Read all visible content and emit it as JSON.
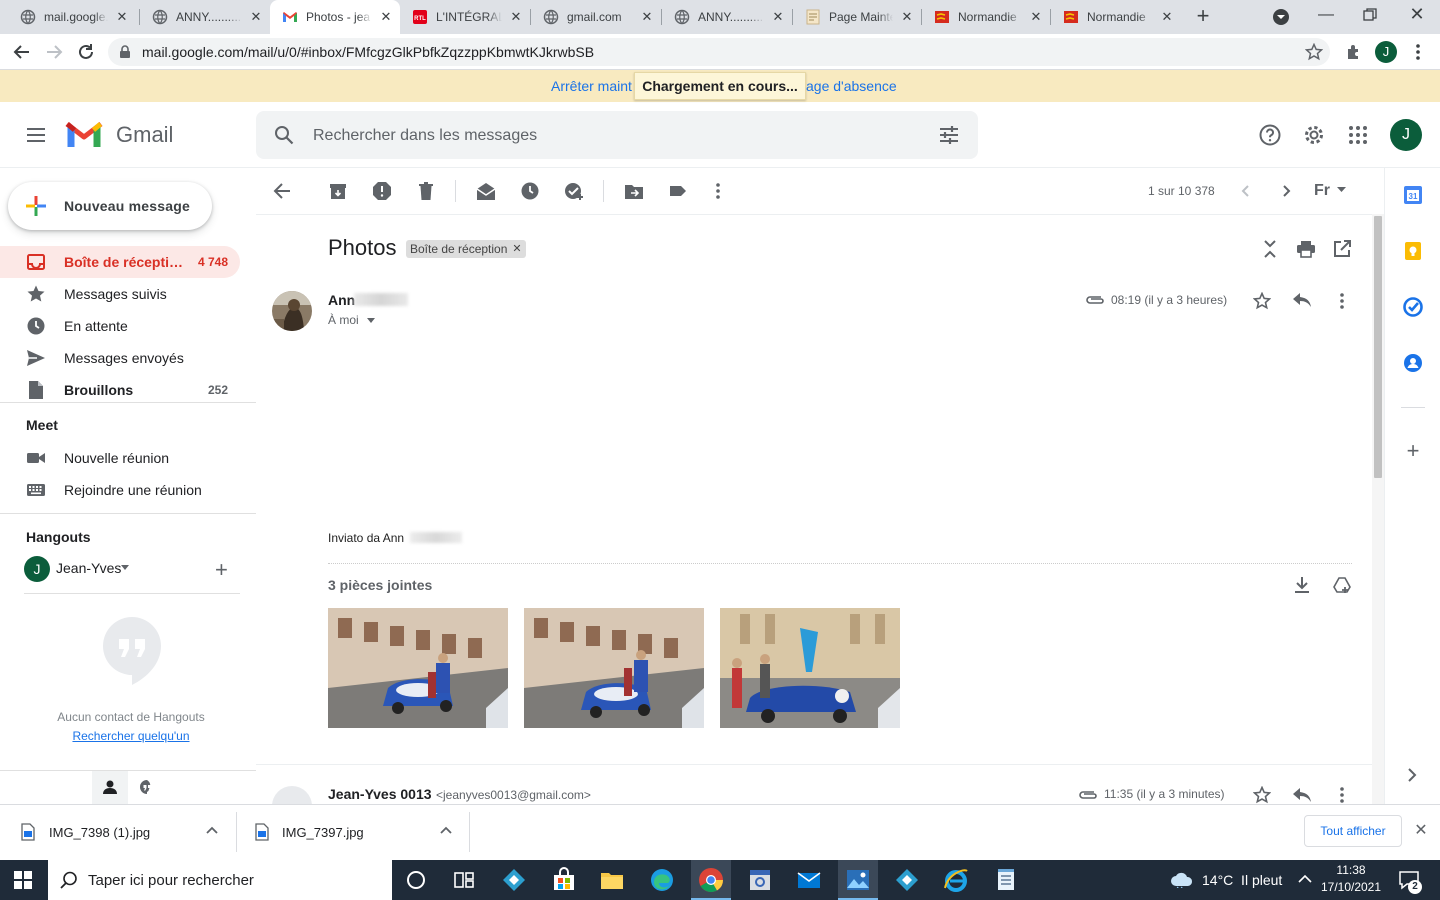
{
  "browser": {
    "tabs": [
      {
        "title": "mail.google.",
        "favicon": "globe-icon"
      },
      {
        "title": "ANNY............",
        "favicon": "globe-icon"
      },
      {
        "title": "Photos - jea",
        "favicon": "gmail-icon",
        "active": true
      },
      {
        "title": "L'INTÉGRALE",
        "favicon": "rtl-icon"
      },
      {
        "title": "gmail.com",
        "favicon": "globe-icon"
      },
      {
        "title": "ANNY............",
        "favicon": "globe-icon"
      },
      {
        "title": "Page Mainte",
        "favicon": "page-icon"
      },
      {
        "title": "Normandie",
        "favicon": "normandie-flag-icon"
      },
      {
        "title": "Normandie",
        "favicon": "normandie-flag-icon"
      }
    ],
    "url": "mail.google.com/mail/u/0/#inbox/FMfcgzGlkPbfkZqzzppKbmwtKJkrwbSB",
    "profile_initial": "J"
  },
  "vacation_bar": {
    "left_text": "Arrêter maint",
    "right_text": "age d'absence",
    "loading": "Chargement en cours..."
  },
  "gmail": {
    "logo_text": "Gmail",
    "search_placeholder": "Rechercher dans les messages",
    "account_initial": "J",
    "compose_label": "Nouveau message",
    "nav": [
      {
        "label": "Boîte de récepti…",
        "count": "4 748",
        "icon": "inbox-icon",
        "active": true
      },
      {
        "label": "Messages suivis",
        "count": "",
        "icon": "star-icon"
      },
      {
        "label": "En attente",
        "count": "",
        "icon": "clock-icon"
      },
      {
        "label": "Messages envoyés",
        "count": "",
        "icon": "send-icon"
      },
      {
        "label": "Brouillons",
        "count": "252",
        "icon": "draft-icon"
      }
    ],
    "meet": {
      "title": "Meet",
      "new_meeting": "Nouvelle réunion",
      "join_meeting": "Rejoindre une réunion"
    },
    "hangouts": {
      "title": "Hangouts",
      "user_initial": "J",
      "user_name": "Jean-Yves",
      "empty_text": "Aucun contact de Hangouts",
      "search_link": "Rechercher quelqu'un"
    },
    "pagination": "1 sur 10 378",
    "lang_label": "Fr",
    "thread": {
      "subject": "Photos",
      "label_chip": "Boîte de réception",
      "message1": {
        "sender": "Ann",
        "recipient": "À moi",
        "time": "08:19 (il y a 3 heures)",
        "body": "Inviato da Ann",
        "attachments_title": "3 pièces jointes"
      },
      "message2": {
        "sender": "Jean-Yves 0013",
        "email": "<jeanyves0013@gmail.com>",
        "time": "11:35 (il y a 3 minutes)"
      }
    }
  },
  "downloads": {
    "items": [
      "IMG_7398 (1).jpg",
      "IMG_7397.jpg"
    ],
    "show_all": "Tout afficher"
  },
  "taskbar": {
    "search_placeholder": "Taper ici pour rechercher",
    "weather": "14°C  Il pleut",
    "time": "11:38",
    "date": "17/10/2021",
    "notifications": "2"
  }
}
